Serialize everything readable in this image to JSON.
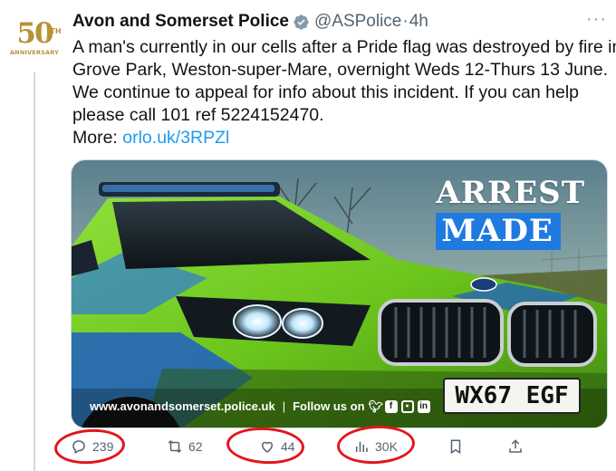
{
  "avatar": {
    "number": "50",
    "superscript": "TH",
    "caption": "ANNIVERSARY"
  },
  "tweet": {
    "display_name": "Avon and Somerset Police",
    "handle": "@ASPolice",
    "separator": "·",
    "time": "4h",
    "more_label": "···",
    "text_lines": [
      "A man's currently in our cells after a Pride flag was destroyed by fire in",
      "Grove Park, Weston-super-Mare, overnight Weds 12-Thurs 13 June.",
      "We continue to appeal for info about this incident. If you can help",
      "please call 101 ref 5224152470."
    ],
    "more_prefix": "More: ",
    "link_text": "orlo.uk/3RPZl"
  },
  "media": {
    "headline_1": "ARREST",
    "headline_2": "MADE",
    "website": "www.avonandsomerset.police.uk",
    "divider": "|",
    "follow": "Follow us on",
    "social_icons": [
      "twitter-icon",
      "facebook-icon",
      "instagram-icon",
      "linkedin-icon"
    ],
    "plate": "WX67 EGF"
  },
  "actions": {
    "replies": "239",
    "reposts": "62",
    "likes": "44",
    "views": "30K"
  },
  "colors": {
    "accent": "#1d9bf0",
    "annotation_red": "#e2161b",
    "gold": "#b89234",
    "police_green": "#7ed321",
    "police_blue": "#1f5fc4"
  }
}
